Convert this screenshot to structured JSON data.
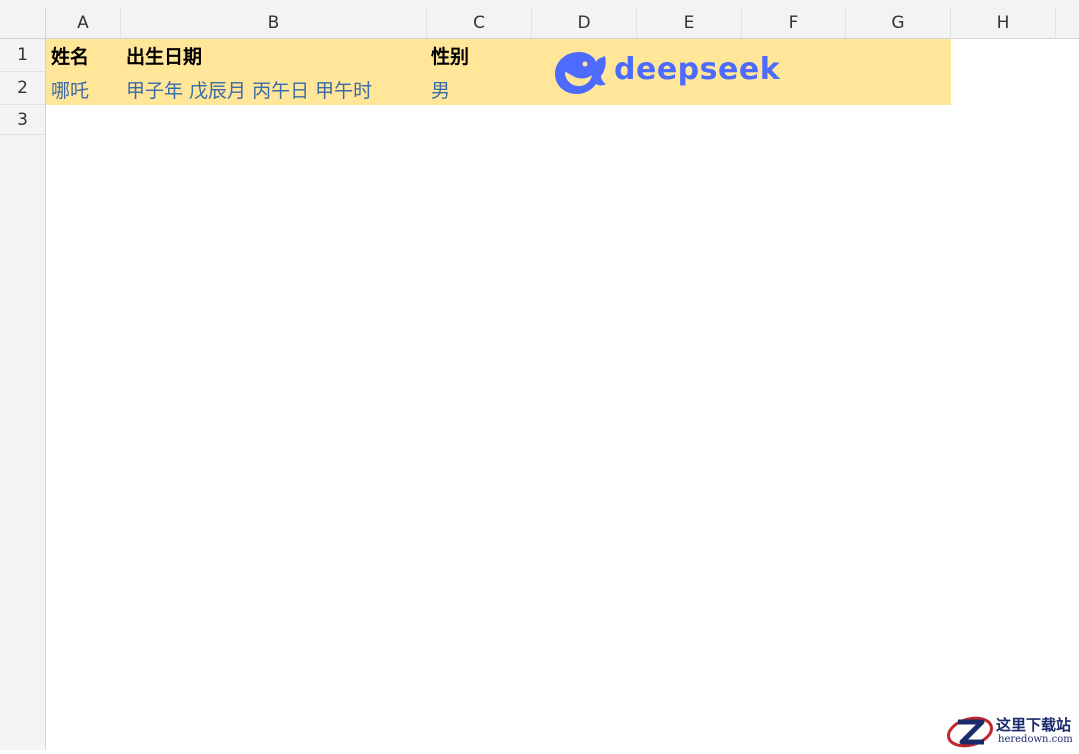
{
  "sheet": {
    "columns": [
      "A",
      "B",
      "C",
      "D",
      "E",
      "F",
      "G",
      "H"
    ],
    "rows": [
      "1",
      "2",
      "3"
    ],
    "header_row": {
      "name": "姓名",
      "birth": "出生日期",
      "gender": "性别"
    },
    "data_row": {
      "name": "哪吒",
      "birth": "甲子年 戊辰月 丙午日 甲午时",
      "gender": "男"
    },
    "band_color": "#ffe699",
    "value_color": "#3a6aa8"
  },
  "logo": {
    "text": "deepseek",
    "icon": "whale-icon",
    "color": "#4d6bfe"
  },
  "watermark": {
    "title": "这里下载站",
    "url": "heredown.com",
    "icon": "z-swoosh-icon"
  }
}
